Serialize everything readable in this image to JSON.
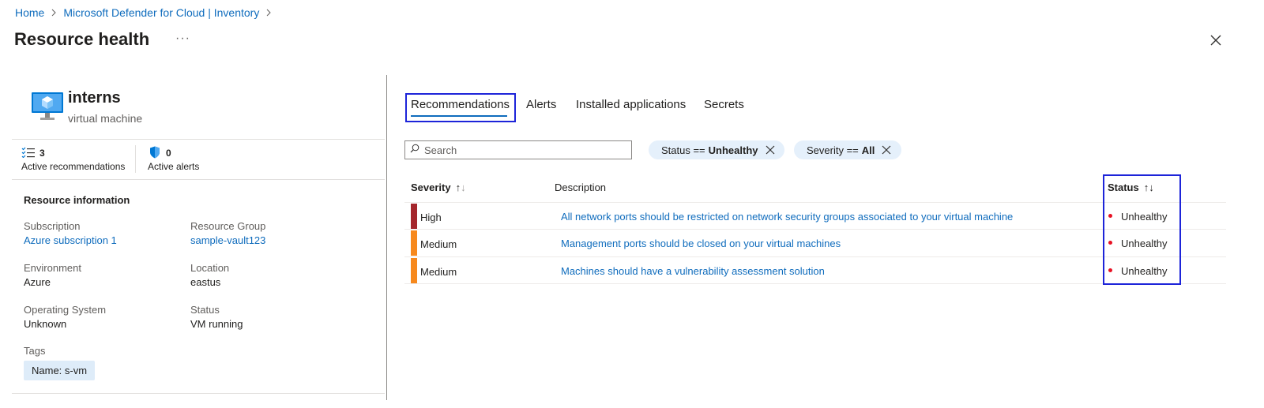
{
  "breadcrumb": {
    "home": "Home",
    "inventory": "Microsoft Defender for Cloud | Inventory",
    "sep": ">"
  },
  "page": {
    "title": "Resource health",
    "more": "···"
  },
  "resource": {
    "name": "interns",
    "type": "virtual machine",
    "stats": {
      "recommendations_count": "3",
      "recommendations_label": "Active recommendations",
      "alerts_count": "0",
      "alerts_label": "Active alerts"
    },
    "info_title": "Resource information",
    "fields": {
      "subscription_key": "Subscription",
      "subscription_val": "Azure subscription 1",
      "rg_key": "Resource Group",
      "rg_val": "sample-vault123",
      "env_key": "Environment",
      "env_val": "Azure",
      "loc_key": "Location",
      "loc_val": "eastus",
      "os_key": "Operating System",
      "os_val": "Unknown",
      "status_key": "Status",
      "status_val": "VM running",
      "tags_key": "Tags",
      "tag_val": "Name: s-vm"
    }
  },
  "tabs": [
    "Recommendations",
    "Alerts",
    "Installed applications",
    "Secrets"
  ],
  "search": {
    "placeholder": "Search"
  },
  "filters": [
    {
      "label": "Status ==",
      "value": "Unhealthy"
    },
    {
      "label": "Severity ==",
      "value": "All"
    }
  ],
  "table": {
    "headers": {
      "severity": "Severity",
      "description": "Description",
      "status": "Status"
    },
    "rows": [
      {
        "severity": "High",
        "description": "All network ports should be restricted on network security groups associated to your virtual machine",
        "status": "Unhealthy"
      },
      {
        "severity": "Medium",
        "description": "Management ports should be closed on your virtual machines",
        "status": "Unhealthy"
      },
      {
        "severity": "Medium",
        "description": "Machines should have a vulnerability assessment solution",
        "status": "Unhealthy"
      }
    ]
  },
  "colors": {
    "link": "#0f6cbd",
    "high": "#a4262c",
    "medium": "#f7891d",
    "unhealthy_dot": "#e81123",
    "highlight_box": "#1d24d9"
  },
  "icons": [
    "chevron-right-icon",
    "more-icon",
    "close-icon",
    "virtual-machine-icon",
    "checklist-icon",
    "shield-icon",
    "search-icon",
    "dismiss-icon",
    "sort-icon"
  ]
}
